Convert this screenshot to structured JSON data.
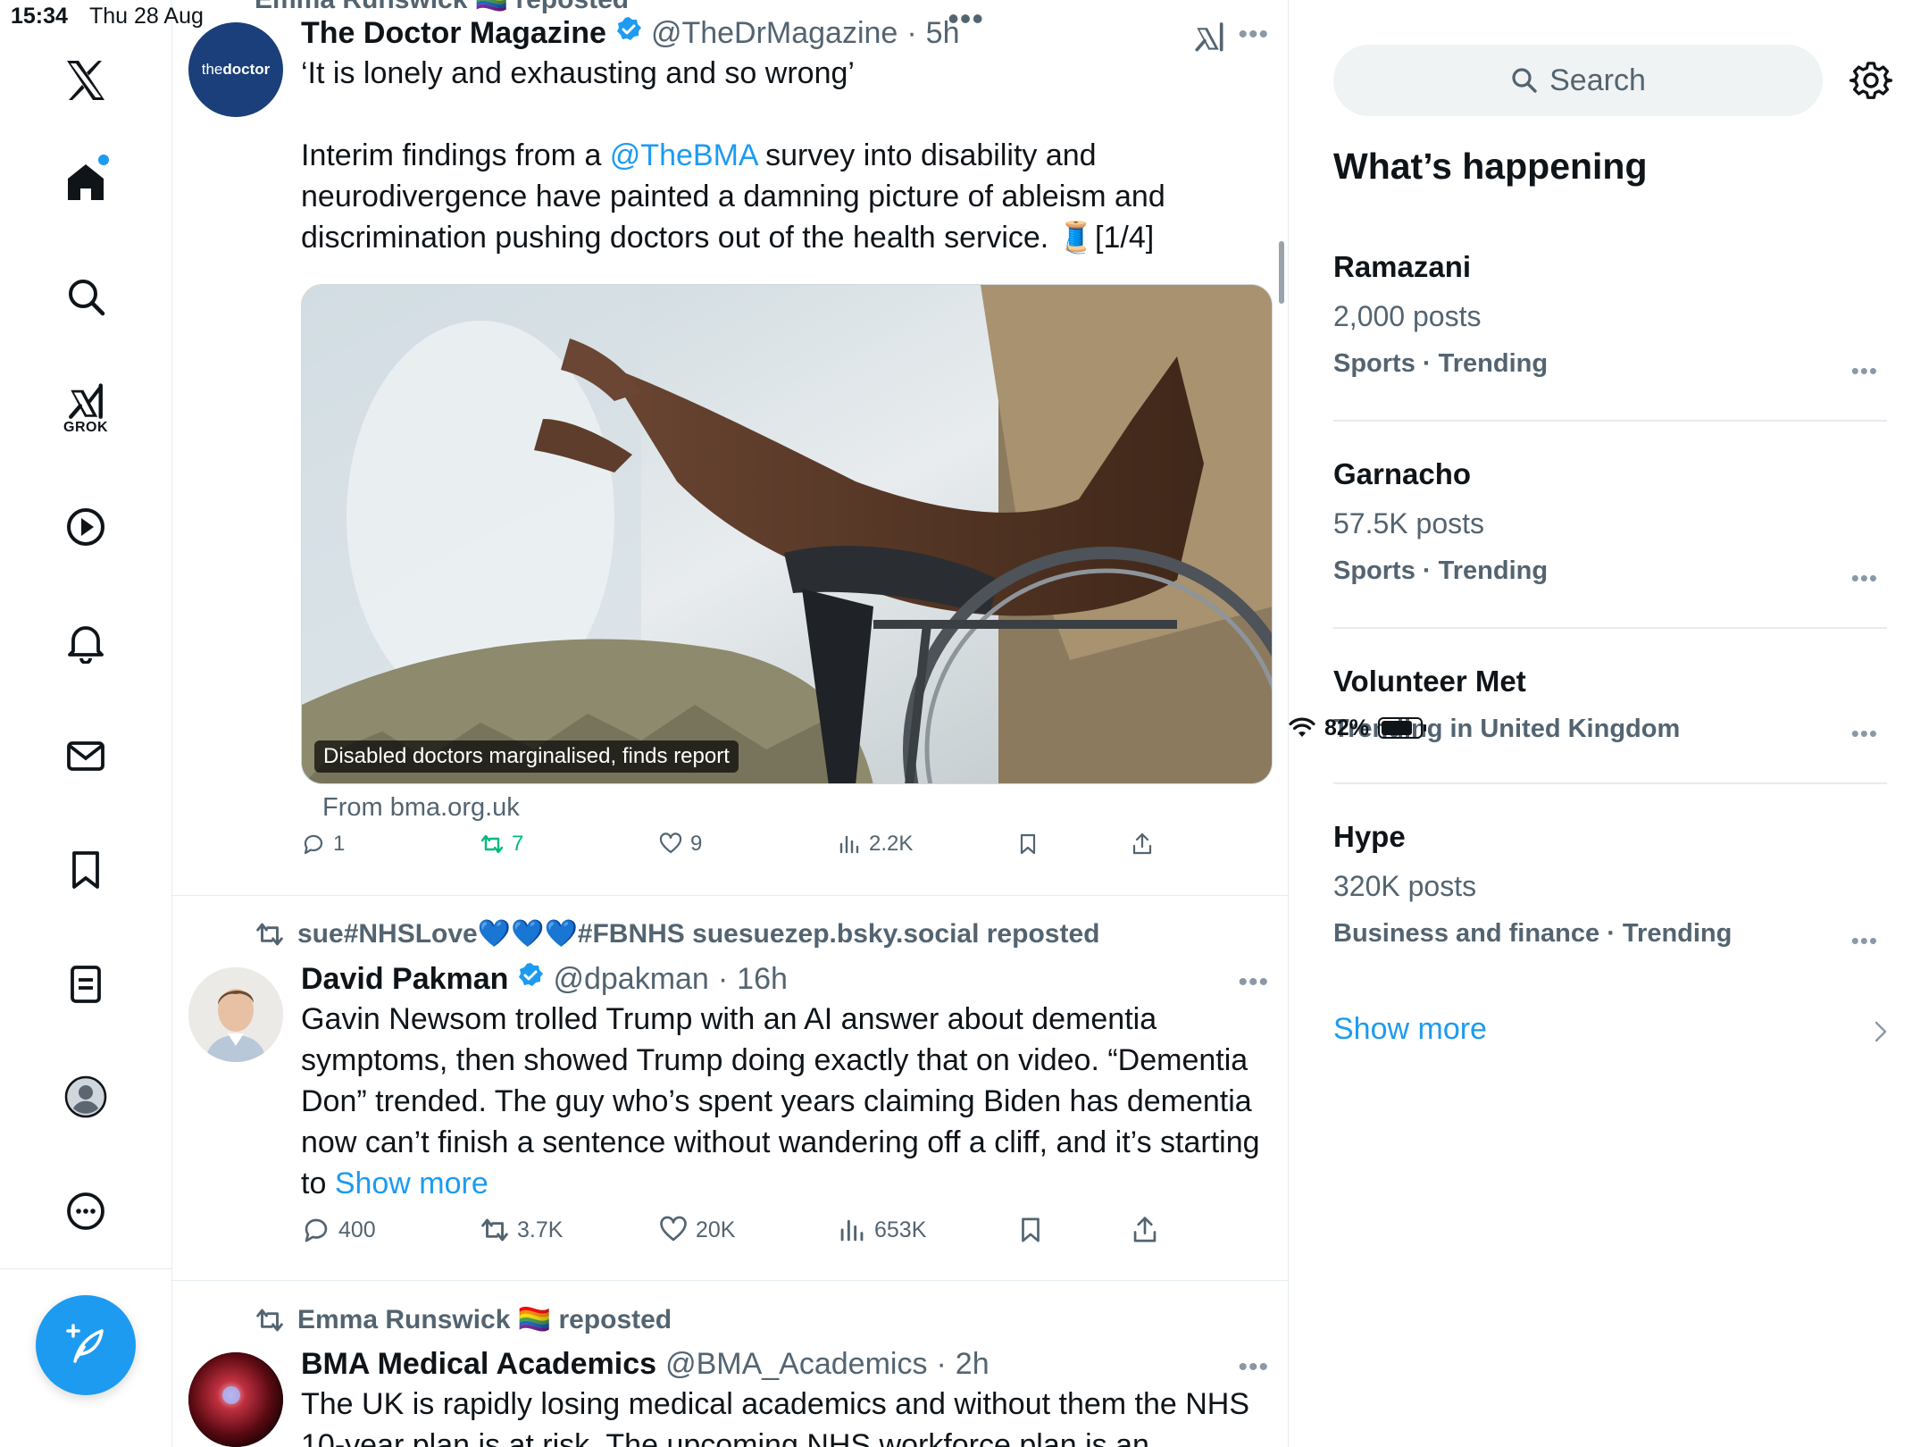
{
  "status_bar": {
    "time": "15:34",
    "date": "Thu 28 Aug",
    "battery": "82%",
    "battery_level": 0.82
  },
  "nav": {
    "grok_label": "GROK",
    "items": [
      "x-logo",
      "home-icon",
      "search-icon",
      "grok-icon",
      "video-icon",
      "bell-icon",
      "mail-icon",
      "bookmark-icon",
      "lists-icon",
      "profile-icon",
      "more-icon"
    ]
  },
  "feed": {
    "partial_repost_top": "Emma Runswick 🏳️‍🌈 reposted",
    "tweets": [
      {
        "name": "The Doctor Magazine",
        "handle": "@TheDrMagazine",
        "time": "5h",
        "avatar_text_a": "the",
        "avatar_text_b": "doctor",
        "text_line1": "‘It is lonely and exhausting and so wrong’",
        "text_pre": "Interim findings from a ",
        "mention": "@TheBMA",
        "text_post": " survey into disability and neurodivergence have painted a damning picture of ableism and discrimination pushing doctors out of the health service. 🧵[1/4]",
        "media_caption": "Disabled doctors marginalised, finds report",
        "from": "From bma.org.uk",
        "replies": "1",
        "reposts": "7",
        "likes": "9",
        "views": "2.2K"
      },
      {
        "repost_by": "sue#NHSLove💙💙💙#FBNHS suesuezep.bsky.social reposted",
        "name": "David Pakman",
        "handle": "@dpakman",
        "time": "16h",
        "text": "Gavin Newsom trolled Trump with an AI answer about dementia symptoms, then showed Trump doing exactly that on video. “Dementia Don” trended. The guy who’s spent years claiming Biden has dementia now can’t finish a sentence without wandering off a cliff, and it’s starting to ",
        "show_more": "Show more",
        "replies": "400",
        "reposts": "3.7K",
        "likes": "20K",
        "views": "653K"
      },
      {
        "repost_by": "Emma Runswick 🏳️‍🌈 reposted",
        "name": "BMA Medical Academics",
        "handle": "@BMA_Academics",
        "time": "2h",
        "text": "The UK is rapidly losing medical academics and without them the NHS 10-year plan is at risk. The upcoming NHS workforce plan is an"
      }
    ]
  },
  "sidebar": {
    "search_placeholder": "Search",
    "whats_happening": "What’s happening",
    "trends": [
      {
        "name": "Ramazani",
        "posts": "2,000 posts",
        "meta": "Sports · Trending"
      },
      {
        "name": "Garnacho",
        "posts": "57.5K posts",
        "meta": "Sports · Trending"
      },
      {
        "name": "Volunteer Met",
        "posts": "",
        "meta": "Trending in United Kingdom"
      },
      {
        "name": "Hype",
        "posts": "320K posts",
        "meta": "Business and finance · Trending"
      }
    ],
    "show_more": "Show more"
  },
  "colors": {
    "accent": "#1d9bf0",
    "text": "#0f1419",
    "muted": "#536471",
    "repost_green": "#00ba7c",
    "divider": "#e6ecf0"
  }
}
